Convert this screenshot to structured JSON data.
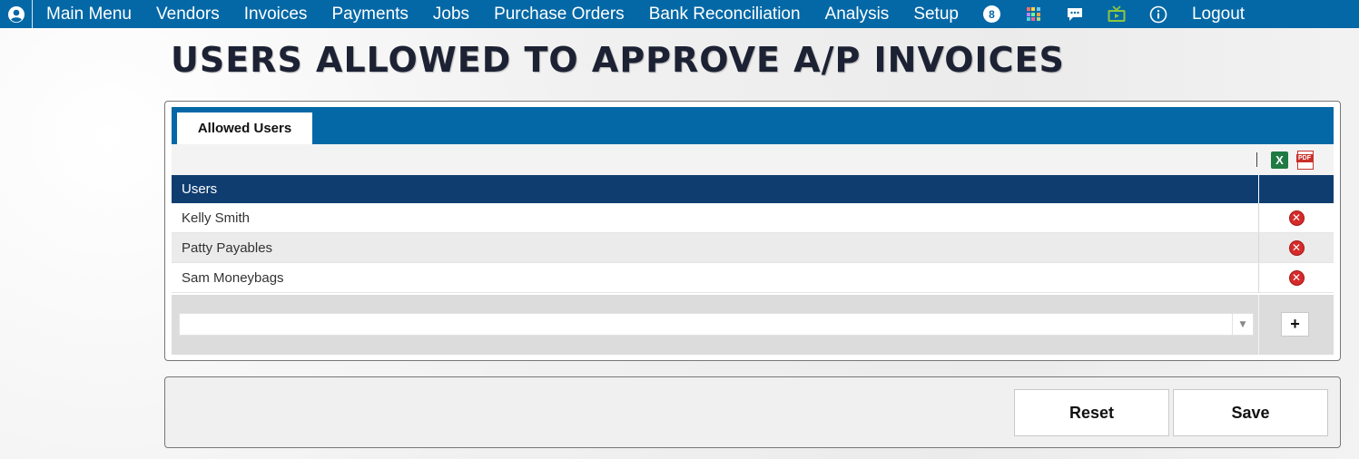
{
  "nav": {
    "items": [
      "Main Menu",
      "Vendors",
      "Invoices",
      "Payments",
      "Jobs",
      "Purchase Orders",
      "Bank Reconciliation",
      "Analysis",
      "Setup"
    ],
    "notification_count": "8",
    "icons": [
      "user-icon",
      "notifications-badge",
      "apps-grid-icon",
      "chat-icon",
      "video-tv-icon",
      "info-icon"
    ],
    "logout_label": "Logout",
    "colors": {
      "bar": "#0468a6",
      "tv_icon": "#8dc63f"
    }
  },
  "page": {
    "title": "USERS ALLOWED TO APPROVE A/P INVOICES"
  },
  "tabs": [
    {
      "label": "Allowed Users",
      "active": true
    }
  ],
  "grid": {
    "export_icons": [
      "excel-icon",
      "pdf-icon"
    ],
    "excel_glyph": "X",
    "pdf_glyph": "PDF",
    "column_header": "Users",
    "rows": [
      {
        "name": "Kelly Smith"
      },
      {
        "name": "Patty Payables"
      },
      {
        "name": "Sam Moneybags"
      }
    ],
    "add_select_value": "",
    "add_button_label": "+",
    "colors": {
      "header": "#0f3d70",
      "delete": "#d52b2b"
    }
  },
  "footer": {
    "reset_label": "Reset",
    "save_label": "Save"
  }
}
